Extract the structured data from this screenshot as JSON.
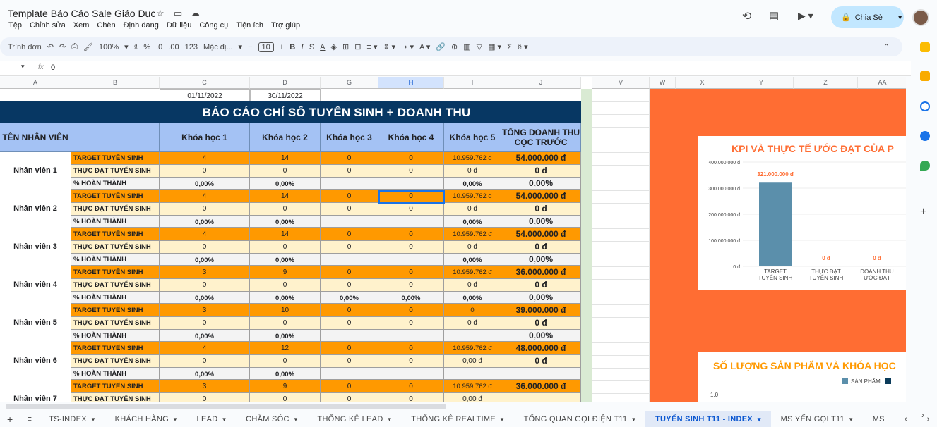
{
  "doc": {
    "title": "Template Báo Cáo Sale Giáo Dục"
  },
  "menu": [
    "Tệp",
    "Chỉnh sửa",
    "Xem",
    "Chèn",
    "Định dạng",
    "Dữ liệu",
    "Công cụ",
    "Tiện ích",
    "Trợ giúp"
  ],
  "share": {
    "label": "Chia Sẻ"
  },
  "toolbar": {
    "search": "Trình đơn",
    "zoom": "100%",
    "currency": "₫",
    "percent": "%",
    "dec_down": ".0",
    "dec_up": ".00",
    "format123": "123",
    "font": "Mặc đị...",
    "font_size": "10"
  },
  "formula": {
    "cell_ref": "",
    "fx": "fx",
    "value": "0"
  },
  "columns": [
    "A",
    "B",
    "C",
    "D",
    "G",
    "H",
    "I",
    "J",
    "V",
    "W",
    "X",
    "Y",
    "Z",
    "AA"
  ],
  "dates": {
    "start": "01/11/2022",
    "end": "30/11/2022"
  },
  "report": {
    "title": "BÁO CÁO CHỈ SỐ TUYỂN SINH + DOANH THU",
    "headers": [
      "TÊN NHÂN VIÊN",
      "",
      "Khóa học 1",
      "Khóa học 2",
      "Khóa học 3",
      "Khóa học 4",
      "Khóa học 5",
      "TỔNG DOANH THU CỌC TRƯỚC"
    ],
    "row_labels": {
      "target": "TARGET TUYỂN SINH",
      "actual": "THỰC ĐẠT TUYỂN SINH",
      "percent": "% HOÀN THÀNH"
    },
    "employees": [
      {
        "name": "Nhân viên 1",
        "target": [
          "4",
          "14",
          "0",
          "0",
          "10.959.762 đ",
          "54.000.000 đ"
        ],
        "actual": [
          "0",
          "0",
          "0",
          "0",
          "0 đ",
          "0 đ"
        ],
        "percent": [
          "0,00%",
          "0,00%",
          "",
          "",
          "0,00%",
          "0,00%"
        ]
      },
      {
        "name": "Nhân viên 2",
        "target": [
          "4",
          "14",
          "0",
          "0",
          "10.959.762 đ",
          "54.000.000 đ"
        ],
        "actual": [
          "0",
          "0",
          "0",
          "0",
          "0 đ",
          "0 đ"
        ],
        "percent": [
          "0,00%",
          "0,00%",
          "",
          "",
          "0,00%",
          "0,00%"
        ]
      },
      {
        "name": "Nhân viên 3",
        "target": [
          "4",
          "14",
          "0",
          "0",
          "10.959.762 đ",
          "54.000.000 đ"
        ],
        "actual": [
          "0",
          "0",
          "0",
          "0",
          "0 đ",
          "0 đ"
        ],
        "percent": [
          "0,00%",
          "0,00%",
          "",
          "",
          "0,00%",
          "0,00%"
        ]
      },
      {
        "name": "Nhân viên 4",
        "target": [
          "3",
          "9",
          "0",
          "0",
          "10.959.762 đ",
          "36.000.000 đ"
        ],
        "actual": [
          "0",
          "0",
          "0",
          "0",
          "0 đ",
          "0 đ"
        ],
        "percent": [
          "0,00%",
          "0,00%",
          "0,00%",
          "0,00%",
          "0,00%",
          "0,00%"
        ]
      },
      {
        "name": "Nhân viên 5",
        "target": [
          "3",
          "10",
          "0",
          "0",
          "0",
          "39.000.000 đ"
        ],
        "actual": [
          "0",
          "0",
          "0",
          "0",
          "0 đ",
          "0 đ"
        ],
        "percent": [
          "0,00%",
          "0,00%",
          "",
          "",
          "",
          "0,00%"
        ]
      },
      {
        "name": "Nhân viên 6",
        "target": [
          "4",
          "12",
          "0",
          "0",
          "10.959.762 đ",
          "48.000.000 đ"
        ],
        "actual": [
          "0",
          "0",
          "0",
          "0",
          "0,00 đ",
          "0 đ"
        ],
        "percent": [
          "0,00%",
          "0,00%",
          "",
          "",
          "",
          ""
        ]
      },
      {
        "name": "Nhân viên 7",
        "target": [
          "3",
          "9",
          "0",
          "0",
          "10.959.762 đ",
          "36.000.000 đ"
        ],
        "actual": [
          "0",
          "0",
          "0",
          "0",
          "0,00 đ",
          ""
        ],
        "percent": [
          "",
          "",
          "",
          "",
          "",
          ""
        ]
      }
    ]
  },
  "chart_data": [
    {
      "type": "bar",
      "title": "KPI VÀ THỰC TẾ ƯỚC ĐẠT CỦA P",
      "categories": [
        "TARGET TUYỂN SINH",
        "THỰC ĐẠT TUYỂN SINH",
        "DOANH THU ƯỚC ĐẠT"
      ],
      "category_lines": [
        [
          "TARGET",
          "TUYỂN SINH"
        ],
        [
          "THỰC ĐẠT",
          "TUYỂN SINH"
        ],
        [
          "DOANH THU",
          "ƯỚC ĐẠT"
        ]
      ],
      "values": [
        321000000,
        0,
        0
      ],
      "data_labels": [
        "321.000.000 đ",
        "0 đ",
        "0 đ"
      ],
      "ylim": [
        0,
        400000000
      ],
      "yticks": [
        "0 đ",
        "100.000.000 đ",
        "200.000.000 đ",
        "300.000.000 đ",
        "400.000.000 đ"
      ],
      "bar_color": "#5b8fab"
    },
    {
      "type": "bar",
      "title": "SỐ LƯỢNG SẢN PHẨM VÀ KHÓA HỌC",
      "legend": [
        "SẢN PHẨM"
      ],
      "ytick_top": "1,0"
    }
  ],
  "sheets": [
    "TS-INDEX",
    "KHÁCH HÀNG",
    "LEAD",
    "CHĂM SÓC",
    "THỐNG KÊ LEAD",
    "THỐNG KÊ REALTIME",
    "TỔNG QUAN GỌI ĐIỆN T11",
    "TUYỂN SINH T11 - INDEX",
    "MS YẾN GỌI T11",
    "MS"
  ],
  "active_sheet": 7
}
